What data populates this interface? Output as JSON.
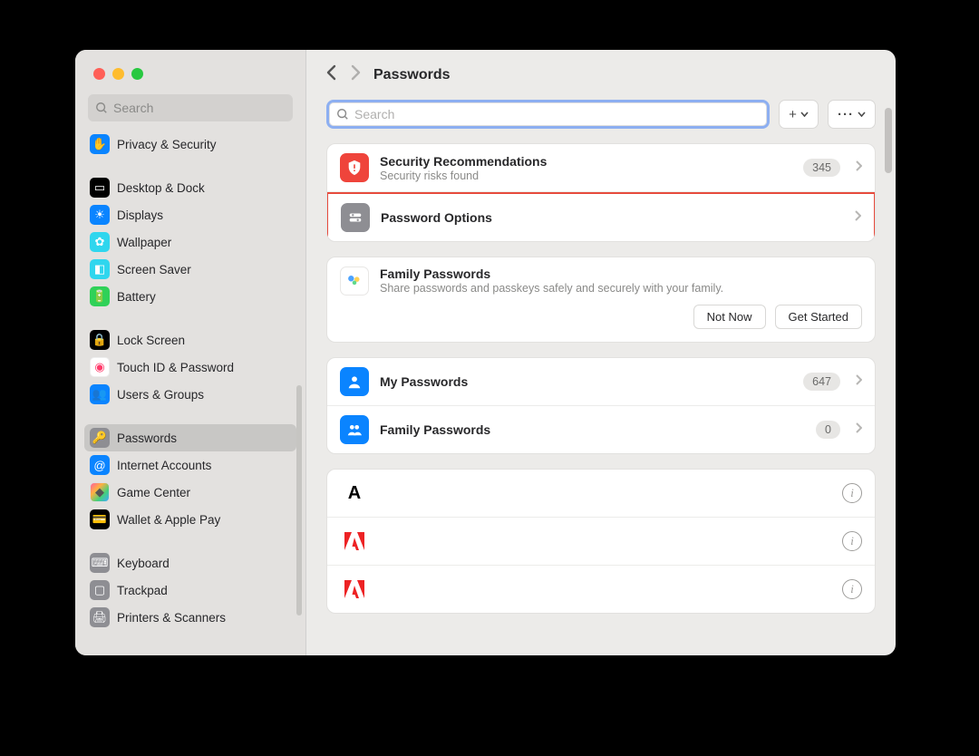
{
  "header": {
    "title": "Passwords"
  },
  "search": {
    "placeholder": "Search",
    "value": ""
  },
  "sidebar": {
    "search_placeholder": "Search",
    "items": [
      {
        "label": "Privacy & Security",
        "icon": "hand-icon",
        "bg": "#0a84ff"
      },
      {
        "sep": true
      },
      {
        "label": "Desktop & Dock",
        "icon": "dock-icon",
        "bg": "#000000"
      },
      {
        "label": "Displays",
        "icon": "sun-icon",
        "bg": "#0a84ff"
      },
      {
        "label": "Wallpaper",
        "icon": "flower-icon",
        "bg": "#2fd6ee"
      },
      {
        "label": "Screen Saver",
        "icon": "screensaver-icon",
        "bg": "#2fd6ee"
      },
      {
        "label": "Battery",
        "icon": "battery-icon",
        "bg": "#30d158"
      },
      {
        "sep": true
      },
      {
        "label": "Lock Screen",
        "icon": "lock-icon",
        "bg": "#000000"
      },
      {
        "label": "Touch ID & Password",
        "icon": "fingerprint-icon",
        "bg": "#ff5f57bf"
      },
      {
        "label": "Users & Groups",
        "icon": "users-icon",
        "bg": "#0a84ff"
      },
      {
        "sep": true
      },
      {
        "label": "Passwords",
        "icon": "key-icon",
        "bg": "#8e8e93",
        "active": true
      },
      {
        "label": "Internet Accounts",
        "icon": "at-icon",
        "bg": "#0a84ff"
      },
      {
        "label": "Game Center",
        "icon": "gamecenter-icon",
        "bg": "#ffffff"
      },
      {
        "label": "Wallet & Apple Pay",
        "icon": "wallet-icon",
        "bg": "#000000"
      },
      {
        "sep": true
      },
      {
        "label": "Keyboard",
        "icon": "keyboard-icon",
        "bg": "#8e8e93"
      },
      {
        "label": "Trackpad",
        "icon": "trackpad-icon",
        "bg": "#8e8e93"
      },
      {
        "label": "Printers & Scanners",
        "icon": "printer-icon",
        "bg": "#8e8e93"
      }
    ]
  },
  "security_recs": {
    "title": "Security Recommendations",
    "subtitle": "Security risks found",
    "count": "345"
  },
  "password_options": {
    "title": "Password Options"
  },
  "family_passwords_promo": {
    "title": "Family Passwords",
    "subtitle": "Share passwords and passkeys safely and securely with your family.",
    "not_now": "Not Now",
    "get_started": "Get Started"
  },
  "my_passwords": {
    "title": "My Passwords",
    "count": "647"
  },
  "family_passwords": {
    "title": "Family Passwords",
    "count": "0"
  }
}
